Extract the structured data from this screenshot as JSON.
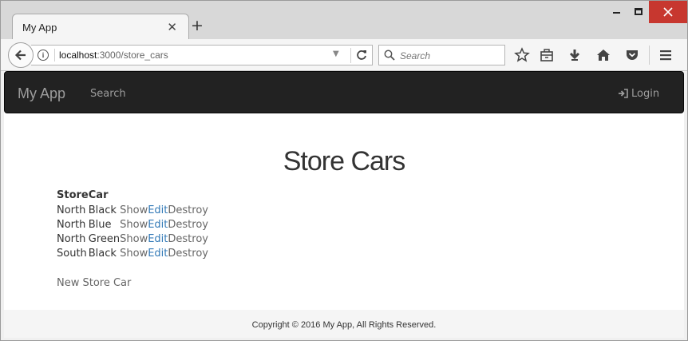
{
  "browser": {
    "tab_title": "My App",
    "tab_close": "✕",
    "new_tab": "+",
    "url_host": "localhost",
    "url_path": ":3000/store_cars",
    "search_placeholder": "Search"
  },
  "app": {
    "brand": "My App",
    "nav_search": "Search",
    "login": "Login"
  },
  "page": {
    "title": "Store Cars",
    "table": {
      "headers": [
        "Store",
        "Car"
      ],
      "rows": [
        {
          "store": "North",
          "car": "Black",
          "show": "Show",
          "edit": "Edit",
          "destroy": "Destroy"
        },
        {
          "store": "North",
          "car": "Blue",
          "show": "Show",
          "edit": "Edit",
          "destroy": "Destroy"
        },
        {
          "store": "North",
          "car": "Green",
          "show": "Show",
          "edit": "Edit",
          "destroy": "Destroy"
        },
        {
          "store": "South",
          "car": "Black",
          "show": "Show",
          "edit": "Edit",
          "destroy": "Destroy"
        }
      ]
    },
    "new_link": "New Store Car"
  },
  "footer": {
    "text": "Copyright © 2016 My App, All Rights Reserved."
  },
  "colors": {
    "navbar_bg": "#222222",
    "nav_text": "#9d9d9d",
    "edit_link": "#337ab7",
    "window_close": "#c7372f"
  }
}
